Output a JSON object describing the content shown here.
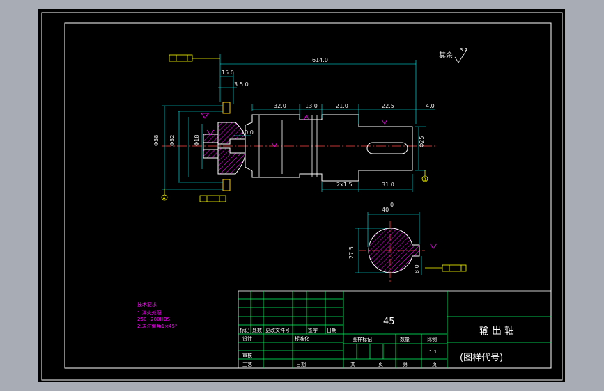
{
  "colors": {
    "background": "#000000",
    "frame": "#ffffff",
    "part_outline": "#ffffff",
    "dimension": "#00ffff",
    "hatch": "#ff00ff",
    "centerline": "#ff4444",
    "title_block": "#00ff66",
    "tolerance_box": "#ffff00",
    "notes": "#ff00ff"
  },
  "roughness_note": {
    "label": "其余",
    "value": "3.2"
  },
  "dimensions": {
    "overall_length": "614.0",
    "d_15": "15.0",
    "d_3_5": "3",
    "d_5": "5.0",
    "d_32": "32.0",
    "d_13": "13.0",
    "d_21": "21.0",
    "d_22_5": "22.5",
    "d_4": "4.0",
    "d_10": "10.0",
    "d_2x1_5": "2x1.5",
    "d_31": "31.0",
    "section_width": "40",
    "section_tol": "0",
    "section_dia": "27.5",
    "key_depth": "8.0"
  },
  "datums": {
    "a": "A",
    "b": "B"
  },
  "notes": {
    "heading": "技术要求",
    "line1": "1.淬火处理",
    "line2": "250~280HBS",
    "line3": "2.未注倒角1×45°"
  },
  "title_block": {
    "material": "45",
    "part_name": "输出轴",
    "drawing_code": "(图样代号)",
    "标记": "标记",
    "处数": "处数",
    "更改文件号": "更改文件号",
    "签字": "签字",
    "日期": "日期",
    "设计": "设计",
    "标准化": "标准化",
    "审核": "审核",
    "工艺": "工艺",
    "日期2": "日期",
    "图样标记": "图样标记",
    "数量": "数量",
    "比例": "比例",
    "scale_value": "1:1",
    "共": "共",
    "页": "页",
    "第": "第",
    "页2": "页"
  }
}
